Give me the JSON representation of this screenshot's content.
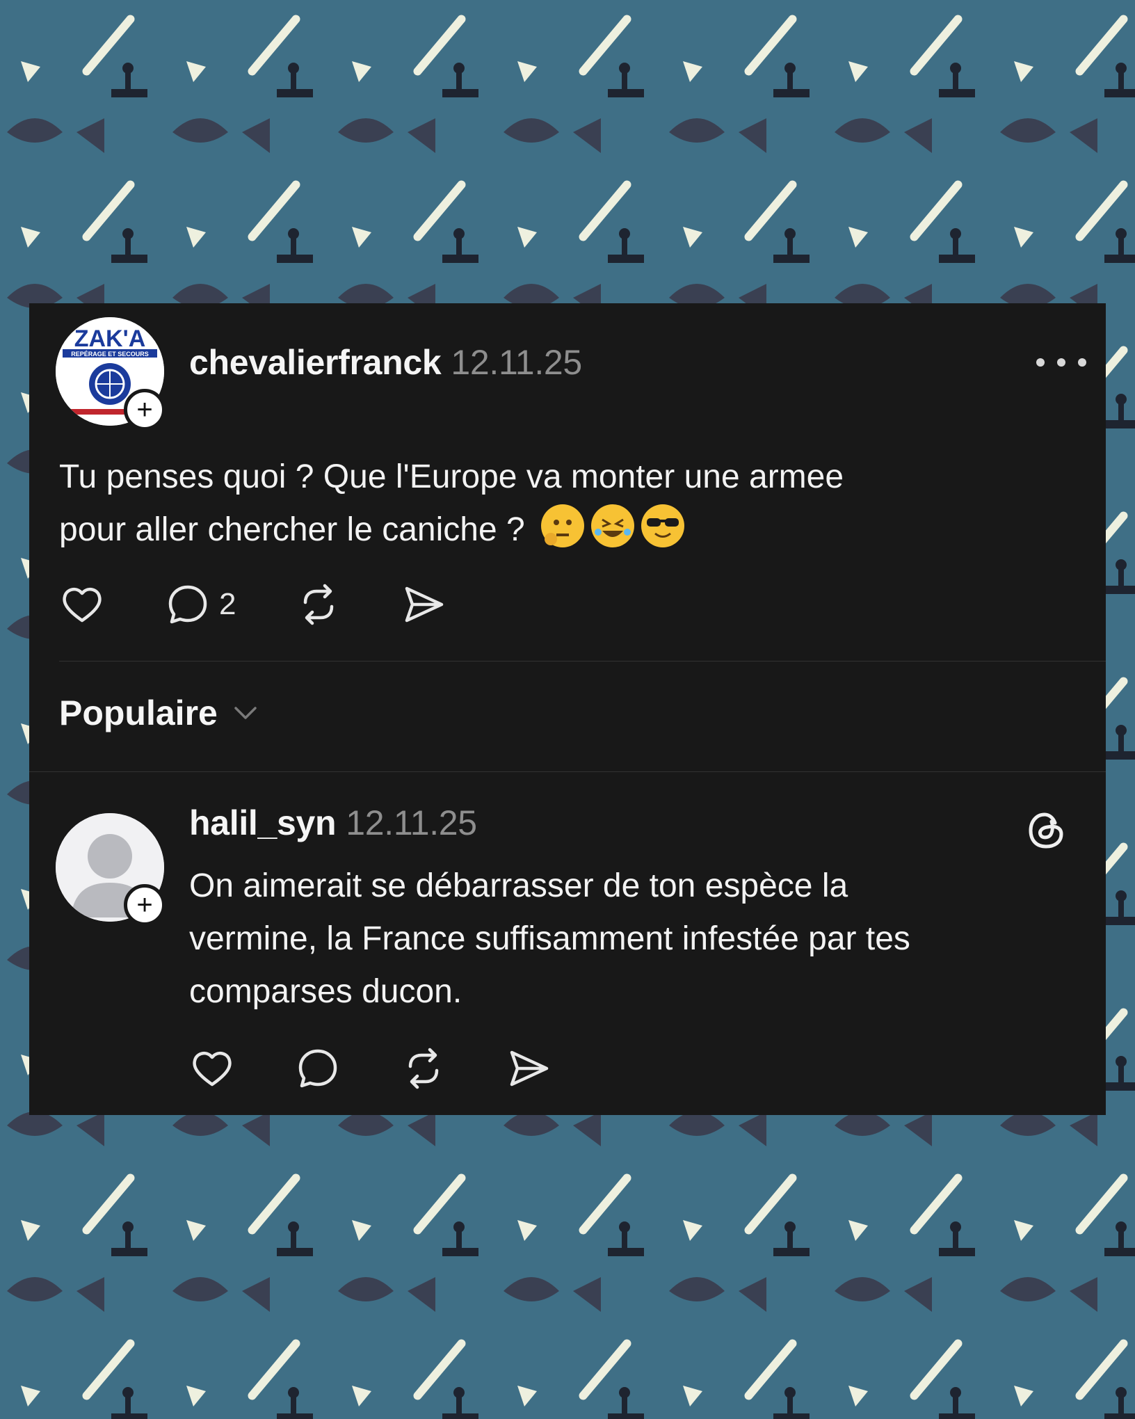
{
  "post": {
    "username": "chevalierfranck",
    "date": "12.11.25",
    "avatar_logo": "ZAK'A",
    "avatar_logo_sub": "REPÉRAGE ET SECOURS",
    "text": "Tu penses quoi ? Que l'Europe va monter une armee\npour aller chercher le caniche ?",
    "emojis": [
      "thinking-face",
      "rolling-on-floor-laughing",
      "smiling-face-with-sunglasses"
    ],
    "reply_count": "2"
  },
  "sort": {
    "label": "Populaire"
  },
  "reply": {
    "username": "halil_syn",
    "date": "12.11.25",
    "text": "On aimerait se débarrasser de ton espèce la\nvermine, la France suffisamment infestée par tes\ncomparses ducon."
  },
  "icons": [
    "heart-icon",
    "comment-icon",
    "repost-icon",
    "share-icon",
    "more-icon",
    "chevron-down-icon",
    "threads-icon",
    "plus-icon"
  ],
  "colors": {
    "background": "#3f6f86",
    "card": "#181818",
    "text": "#f3f3f3",
    "muted": "#8e8e8e"
  }
}
